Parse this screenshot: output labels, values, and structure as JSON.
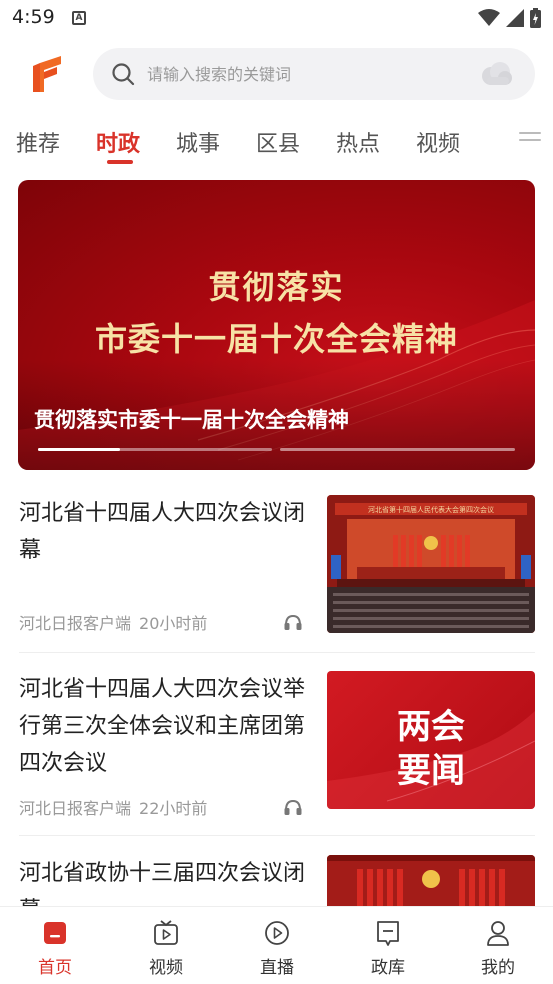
{
  "status_bar": {
    "time": "4:59",
    "notification_letter": "A"
  },
  "search": {
    "placeholder": "请输入搜索的关键词"
  },
  "tabs": [
    {
      "label": "推荐",
      "active": false
    },
    {
      "label": "时政",
      "active": true
    },
    {
      "label": "城事",
      "active": false
    },
    {
      "label": "区县",
      "active": false
    },
    {
      "label": "热点",
      "active": false
    },
    {
      "label": "视频",
      "active": false
    }
  ],
  "banner": {
    "image_line1": "贯彻落实",
    "image_line2": "市委十一届十次全会精神",
    "caption": "贯彻落实市委十一届十次全会精神",
    "slide_count": 4,
    "active_slide": 1
  },
  "news": [
    {
      "title": "河北省十四届人大四次会议闭幕",
      "source": "河北日报客户端",
      "time": "20小时前",
      "thumb_text": "河北省第十四届人民代表大会第四次会议"
    },
    {
      "title": "河北省十四届人大四次会议举行第三次全体会议和主席团第四次会议",
      "source": "河北日报客户端",
      "time": "22小时前",
      "thumb_line1": "两会",
      "thumb_line2": "要闻"
    },
    {
      "title": "河北省政协十三届四次会议闭幕"
    }
  ],
  "bottom_nav": [
    {
      "label": "首页",
      "icon": "home-icon",
      "active": true
    },
    {
      "label": "视频",
      "icon": "tv-icon",
      "active": false
    },
    {
      "label": "直播",
      "icon": "play-icon",
      "active": false
    },
    {
      "label": "政库",
      "icon": "bookmark-icon",
      "active": false
    },
    {
      "label": "我的",
      "icon": "person-icon",
      "active": false
    }
  ],
  "colors": {
    "accent": "#d9332a",
    "banner_red": "#a8070f",
    "banner_gold": "#f7e2a6",
    "search_bg": "#f2f2f4",
    "meta_gray": "#999999"
  }
}
